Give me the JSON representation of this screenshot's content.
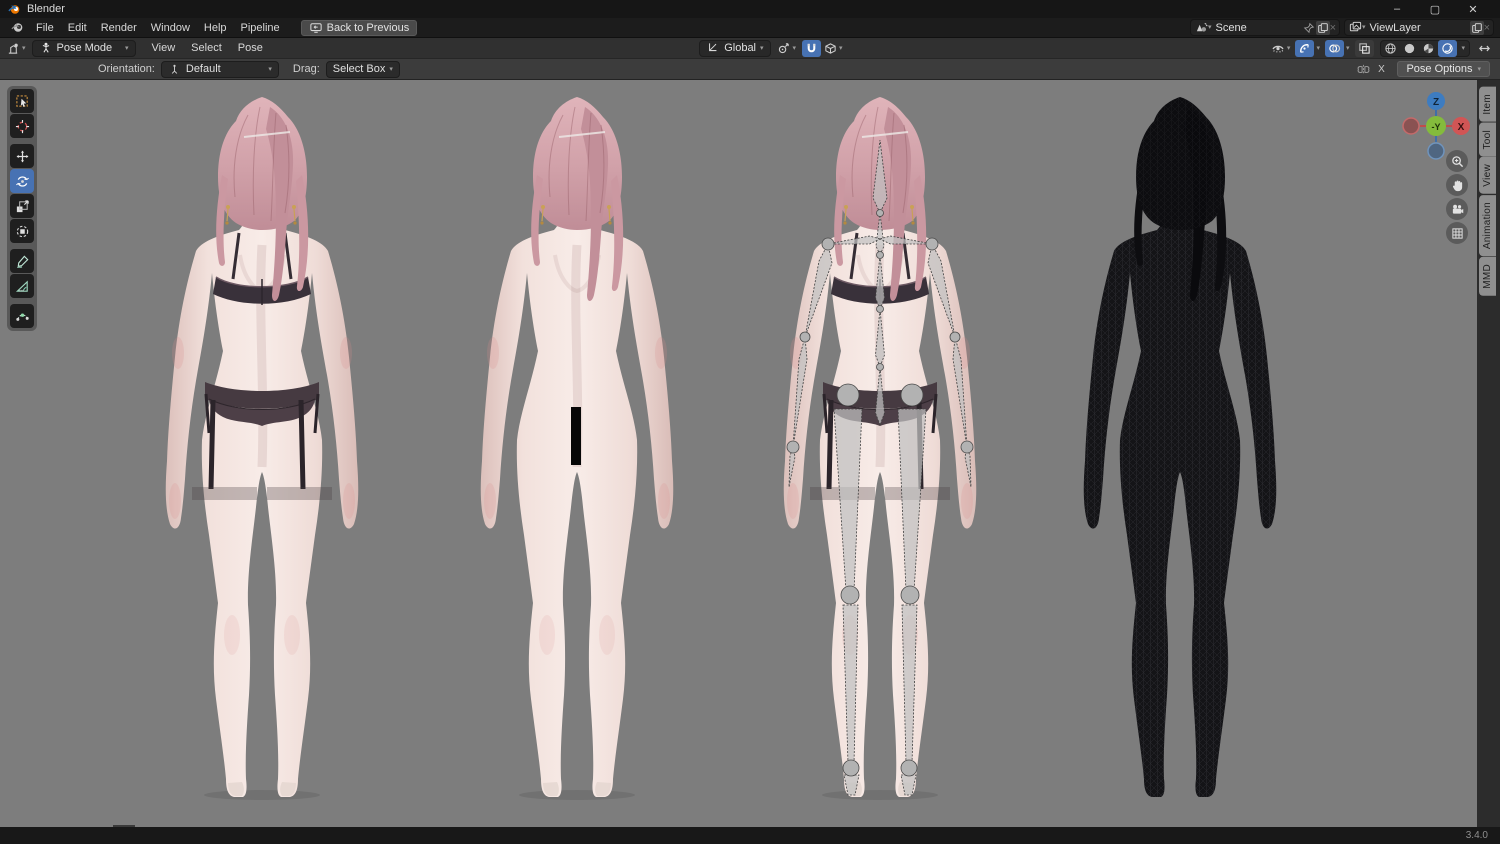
{
  "titlebar": {
    "title": "Blender"
  },
  "window_controls": {
    "minimize": "–",
    "maximize": "▢",
    "close": "✕"
  },
  "menubar": {
    "items": [
      "File",
      "Edit",
      "Render",
      "Window",
      "Help",
      "Pipeline"
    ],
    "back_button": "Back to Previous"
  },
  "selectors": {
    "scene": {
      "value": "Scene",
      "unlink": "×"
    },
    "view_layer": {
      "value": "ViewLayer",
      "unlink": "×"
    }
  },
  "editor_header": {
    "mode": "Pose Mode",
    "menus": [
      "View",
      "Select",
      "Pose"
    ],
    "transform_orientation": "Global"
  },
  "tool_settings": {
    "orientation_label": "Orientation:",
    "orientation_value": "Default",
    "drag_label": "Drag:",
    "drag_value": "Select Box",
    "mirror_axis": "X",
    "pose_options": "Pose Options"
  },
  "toolbar_tools": [
    {
      "name": "select-box"
    },
    {
      "name": "cursor"
    },
    {
      "name": "move"
    },
    {
      "name": "rotate",
      "active": true
    },
    {
      "name": "scale"
    },
    {
      "name": "transform"
    },
    {
      "name": "annotate"
    },
    {
      "name": "measure"
    },
    {
      "name": "pose-breakdowner"
    }
  ],
  "sidebar_tabs": [
    "Item",
    "Tool",
    "View",
    "Animation",
    "MMD"
  ],
  "gizmo": {
    "axis_top": "Z",
    "axis_right": "X",
    "axis_center": "-Y"
  },
  "nav_buttons": [
    "zoom",
    "pan",
    "camera-view",
    "toggle-orthographic"
  ],
  "figures": [
    {
      "name": "textured-lingerie-model"
    },
    {
      "name": "base-skin-model"
    },
    {
      "name": "armature-overlay-model"
    },
    {
      "name": "wireframe-model"
    }
  ],
  "statusbar": {
    "version": "3.4.0"
  },
  "colors": {
    "accent_blue": "#4772b3",
    "viewport_background": "#7d7d7d",
    "skin": "#f2e0db",
    "hair_pink": "#d2a3a9",
    "lingerie_dark": "#3a3136",
    "bone_gray": "#bebebe",
    "wireframe_black": "#141417"
  },
  "glyphs": {
    "chevron": "▾"
  }
}
